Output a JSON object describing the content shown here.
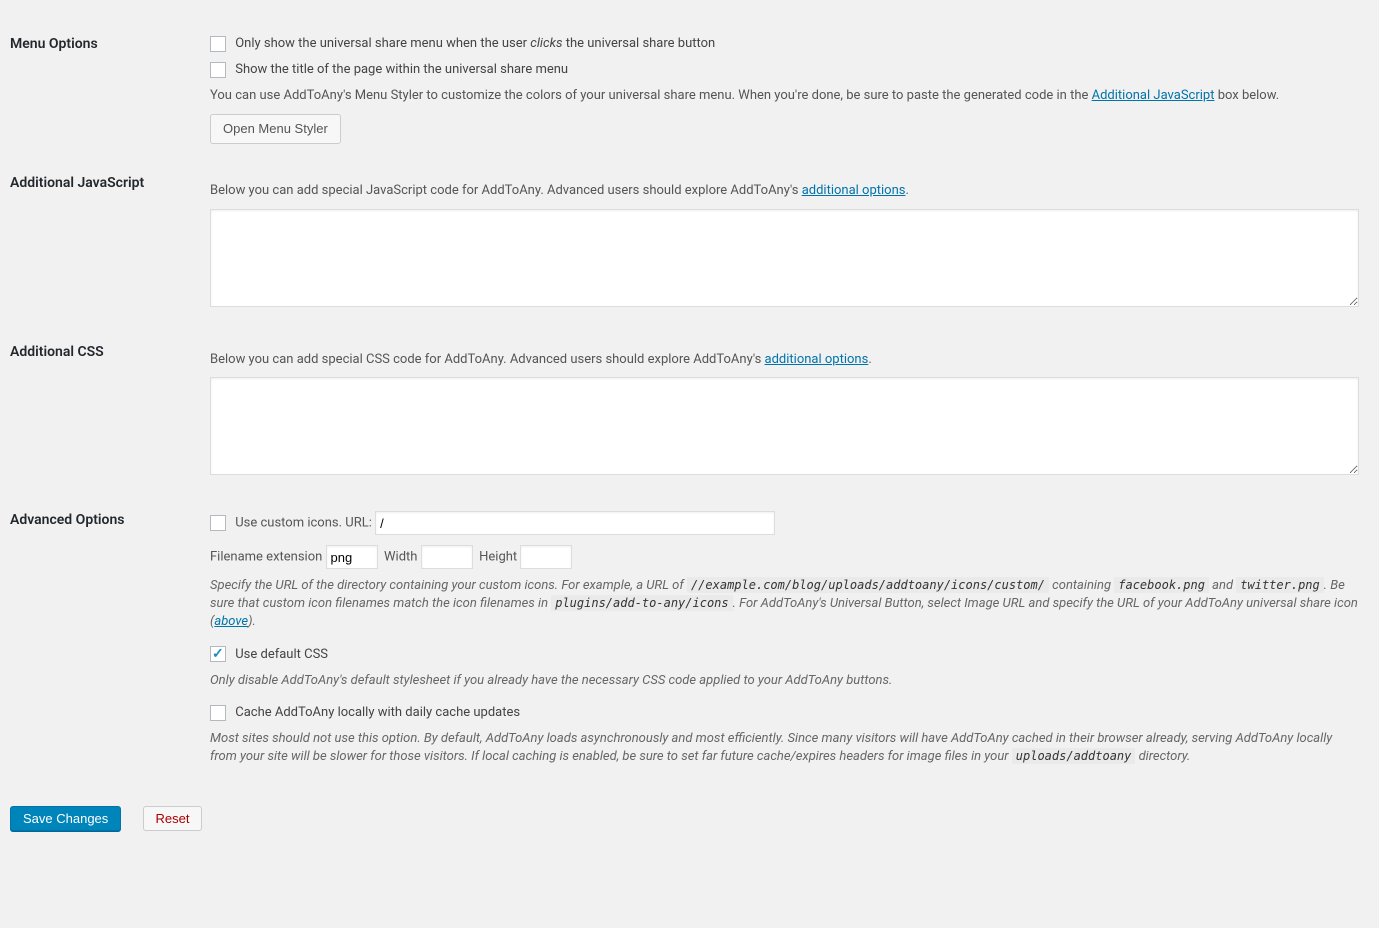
{
  "sections": {
    "menu_options": {
      "heading": "Menu Options",
      "cb1_label_a": "Only show the universal share menu when the user ",
      "cb1_label_em": "clicks",
      "cb1_label_b": " the universal share button",
      "cb2_label": "Show the title of the page within the universal share menu",
      "styler_text_a": "You can use AddToAny's Menu Styler to customize the colors of your universal share menu. When you're done, be sure to paste the generated code in the ",
      "styler_link": "Additional JavaScript",
      "styler_text_b": " box below.",
      "open_styler_btn": "Open Menu Styler"
    },
    "additional_js": {
      "heading": "Additional JavaScript",
      "intro_a": "Below you can add special JavaScript code for AddToAny. Advanced users should explore AddToAny's ",
      "intro_link": "additional options",
      "intro_b": "."
    },
    "additional_css": {
      "heading": "Additional CSS",
      "intro_a": "Below you can add special CSS code for AddToAny. Advanced users should explore AddToAny's ",
      "intro_link": "additional options",
      "intro_b": "."
    },
    "advanced": {
      "heading": "Advanced Options",
      "custom_icons_label": "Use custom icons. URL:",
      "custom_icons_url_value": "/",
      "filename_ext_label": "Filename extension",
      "filename_ext_value": "png",
      "width_label": "Width",
      "width_value": "",
      "height_label": "Height",
      "height_value": "",
      "desc1_a": "Specify the URL of the directory containing your custom icons. For example, a URL of ",
      "desc1_code1": "//example.com/blog/uploads/addtoany/icons/custom/",
      "desc1_b": " containing ",
      "desc1_code2": "facebook.png",
      "desc1_c": " and ",
      "desc1_code3": "twitter.png",
      "desc1_d": ". Be sure that custom icon filenames match the icon filenames in ",
      "desc1_code4": "plugins/add-to-any/icons",
      "desc1_e": ". For AddToAny's Universal Button, select Image URL and specify the URL of your AddToAny universal share icon (",
      "desc1_link": "above",
      "desc1_f": ").",
      "use_default_css_label": "Use default CSS",
      "desc2": "Only disable AddToAny's default stylesheet if you already have the necessary CSS code applied to your AddToAny buttons.",
      "cache_label": "Cache AddToAny locally with daily cache updates",
      "desc3_a": "Most sites should not use this option. By default, AddToAny loads asynchronously and most efficiently. Since many visitors will have AddToAny cached in their browser already, serving AddToAny locally from your site will be slower for those visitors. If local caching is enabled, be sure to set far future cache/expires headers for image files in your ",
      "desc3_code": "uploads/addtoany",
      "desc3_b": " directory."
    }
  },
  "buttons": {
    "save": "Save Changes",
    "reset": "Reset"
  }
}
